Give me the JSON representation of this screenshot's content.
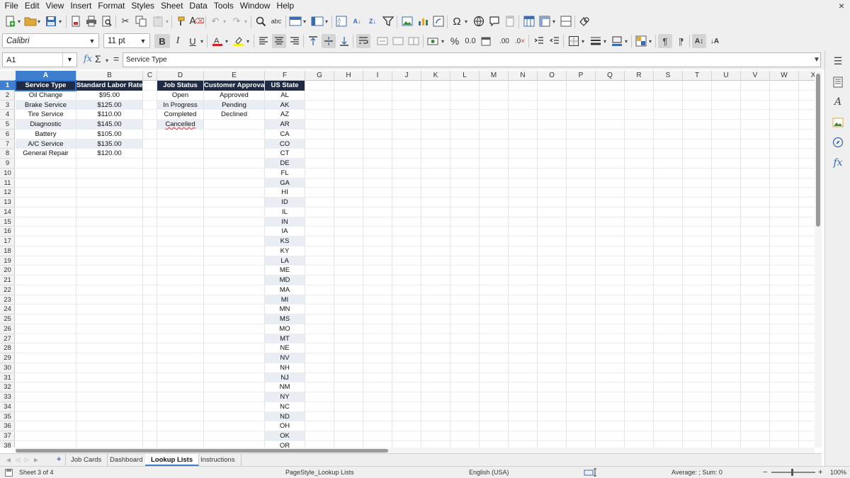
{
  "menu": [
    "File",
    "Edit",
    "View",
    "Insert",
    "Format",
    "Styles",
    "Sheet",
    "Data",
    "Tools",
    "Window",
    "Help"
  ],
  "window": {
    "close_glyph": "×"
  },
  "font_name": "Calibri",
  "font_size": "11 pt",
  "toolbar2": {
    "bold": "B",
    "italic": "I",
    "underline": "U",
    "percent": "%",
    "decimals": "0.0"
  },
  "namebox": "A1",
  "formula": {
    "fx": "fx",
    "sigma": "Σ",
    "equals": "=",
    "content": "Service Type"
  },
  "columns": [
    "A",
    "B",
    "C",
    "D",
    "E",
    "F",
    "G",
    "H",
    "I",
    "J",
    "K",
    "L",
    "M",
    "N",
    "O",
    "P",
    "Q",
    "R",
    "S",
    "T",
    "U",
    "V",
    "W",
    "X"
  ],
  "rows": [
    "1",
    "2",
    "3",
    "4",
    "5",
    "6",
    "7",
    "8",
    "9",
    "10",
    "11",
    "12",
    "13",
    "14",
    "15",
    "16",
    "17",
    "18",
    "19",
    "20",
    "21",
    "22",
    "23",
    "24",
    "25",
    "26",
    "27",
    "28",
    "29",
    "30",
    "31",
    "32",
    "33",
    "34",
    "35",
    "36",
    "37",
    "38"
  ],
  "headers": {
    "A": "Service Type",
    "B": "Standard Labor Rate",
    "D": "Job Status",
    "E": "Customer Approval",
    "F": "US State"
  },
  "service_types": [
    "Oil Change",
    "Brake Service",
    "Tire Service",
    "Diagnostic",
    "Battery",
    "A/C Service",
    "General Repair"
  ],
  "labor_rates": [
    "$95.00",
    "$125.00",
    "$110.00",
    "$145.00",
    "$105.00",
    "$135.00",
    "$120.00"
  ],
  "job_status": [
    "Open",
    "In Progress",
    "Completed",
    "Cancelled"
  ],
  "customer_approval": [
    "Approved",
    "Pending",
    "Declined"
  ],
  "us_states": [
    "AL",
    "AK",
    "AZ",
    "AR",
    "CA",
    "CO",
    "CT",
    "DE",
    "FL",
    "GA",
    "HI",
    "ID",
    "IL",
    "IN",
    "IA",
    "KS",
    "KY",
    "LA",
    "ME",
    "MD",
    "MA",
    "MI",
    "MN",
    "MS",
    "MO",
    "MT",
    "NE",
    "NV",
    "NH",
    "NJ",
    "NM",
    "NY",
    "NC",
    "ND",
    "OH",
    "OK",
    "OR"
  ],
  "tabs": {
    "add_sheet": "+",
    "items": [
      "Job Cards",
      "Dashboard",
      "Lookup Lists",
      "Instructions"
    ],
    "active": "Lookup Lists"
  },
  "status": {
    "sheet": "Sheet 3 of 4",
    "page_style": "PageStyle_Lookup Lists",
    "language": "English (USA)",
    "summary": "Average: ; Sum: 0",
    "zoom": "100%",
    "zoom_minus": "−",
    "zoom_plus": "+"
  },
  "colors": {
    "header_fill": "#1f2a44",
    "alt_fill": "#e9eef5",
    "selection": "#3d7ecf"
  }
}
